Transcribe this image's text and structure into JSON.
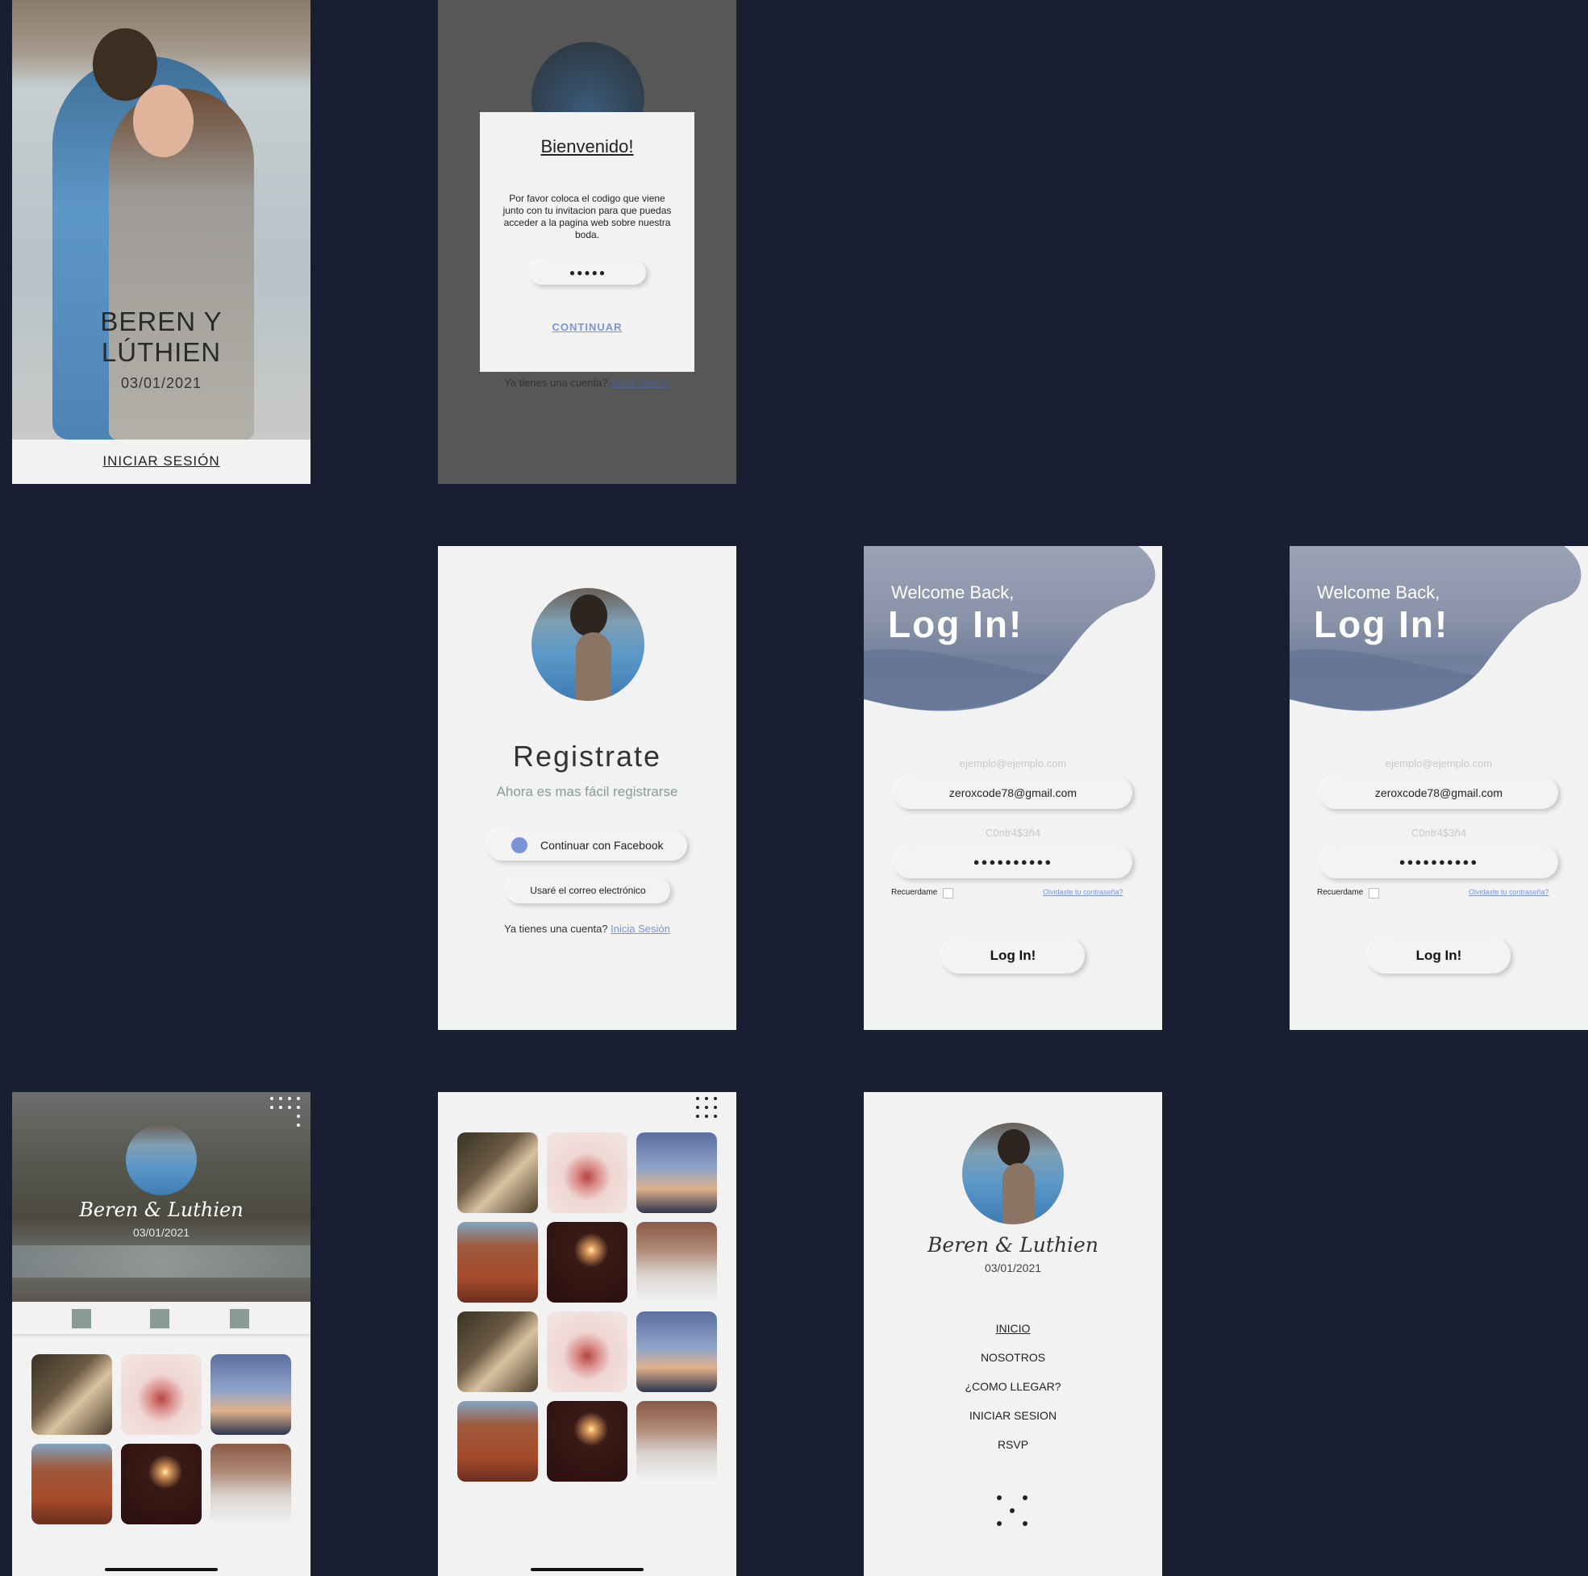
{
  "colors": {
    "background": "#1a1e33",
    "screen": "#f2f2f2",
    "accent": "#7a95d6",
    "text_dark": "#222222"
  },
  "splash": {
    "title": "BEREN Y LÚTHIEN",
    "date": "03/01/2021",
    "login": "INICIAR SESIÓN"
  },
  "welcome_dialog": {
    "title": "Bienvenido!",
    "message": "Por favor coloca el codigo que viene junto con tu invitacion para que puedas acceder a la pagina web sobre nuestra boda.",
    "code_value": "●●●●●",
    "continue": "CONTINUAR",
    "footer_text": "Ya tienes una cuenta?",
    "footer_link": "Inicia Sesión"
  },
  "register": {
    "title": "Registrate",
    "subtitle": "Ahora es mas fácil registrarse",
    "facebook": "Continuar con Facebook",
    "email": "Usaré el correo electrónico",
    "footer_text": "Ya tienes una cuenta?",
    "footer_link": "Inicia Sesión"
  },
  "login": {
    "welcome": "Welcome Back,",
    "title": "Log In!",
    "email_placeholder": "ejemplo@ejemplo.com",
    "email_value": "zeroxcode78@gmail.com",
    "password_placeholder": "C0ntr4$3ñ4",
    "password_value": "●●●●●●●●●●",
    "remember": "Recuerdame",
    "forgot": "Olvidaste tu contraseña?",
    "button": "Log In!"
  },
  "home": {
    "names": "Beren & Luthien",
    "date": "03/01/2021"
  },
  "menu": {
    "names": "Beren & Luthien",
    "date": "03/01/2021",
    "items": [
      "INICIO",
      "NOSOTROS",
      "¿COMO LLEGAR?",
      "INICIAR SESION",
      "RSVP"
    ]
  },
  "gallery": {
    "tiles": [
      "couple-kiss",
      "flower-centerpiece",
      "couple-silhouette",
      "brick-building",
      "candle-cake",
      "window-arch"
    ]
  }
}
